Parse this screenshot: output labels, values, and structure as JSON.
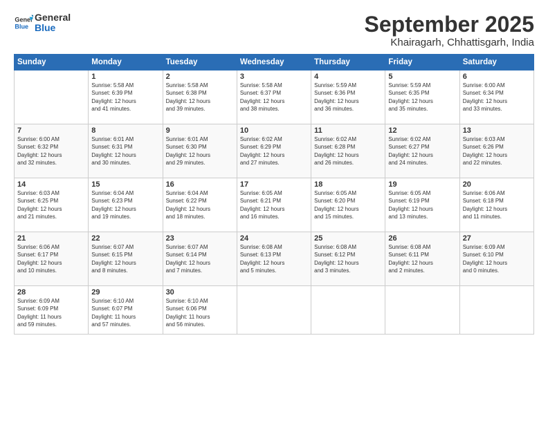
{
  "logo": {
    "line1": "General",
    "line2": "Blue"
  },
  "title": "September 2025",
  "subtitle": "Khairagarh, Chhattisgarh, India",
  "headers": [
    "Sunday",
    "Monday",
    "Tuesday",
    "Wednesday",
    "Thursday",
    "Friday",
    "Saturday"
  ],
  "weeks": [
    [
      {
        "num": "",
        "info": ""
      },
      {
        "num": "1",
        "info": "Sunrise: 5:58 AM\nSunset: 6:39 PM\nDaylight: 12 hours\nand 41 minutes."
      },
      {
        "num": "2",
        "info": "Sunrise: 5:58 AM\nSunset: 6:38 PM\nDaylight: 12 hours\nand 39 minutes."
      },
      {
        "num": "3",
        "info": "Sunrise: 5:58 AM\nSunset: 6:37 PM\nDaylight: 12 hours\nand 38 minutes."
      },
      {
        "num": "4",
        "info": "Sunrise: 5:59 AM\nSunset: 6:36 PM\nDaylight: 12 hours\nand 36 minutes."
      },
      {
        "num": "5",
        "info": "Sunrise: 5:59 AM\nSunset: 6:35 PM\nDaylight: 12 hours\nand 35 minutes."
      },
      {
        "num": "6",
        "info": "Sunrise: 6:00 AM\nSunset: 6:34 PM\nDaylight: 12 hours\nand 33 minutes."
      }
    ],
    [
      {
        "num": "7",
        "info": "Sunrise: 6:00 AM\nSunset: 6:32 PM\nDaylight: 12 hours\nand 32 minutes."
      },
      {
        "num": "8",
        "info": "Sunrise: 6:01 AM\nSunset: 6:31 PM\nDaylight: 12 hours\nand 30 minutes."
      },
      {
        "num": "9",
        "info": "Sunrise: 6:01 AM\nSunset: 6:30 PM\nDaylight: 12 hours\nand 29 minutes."
      },
      {
        "num": "10",
        "info": "Sunrise: 6:02 AM\nSunset: 6:29 PM\nDaylight: 12 hours\nand 27 minutes."
      },
      {
        "num": "11",
        "info": "Sunrise: 6:02 AM\nSunset: 6:28 PM\nDaylight: 12 hours\nand 26 minutes."
      },
      {
        "num": "12",
        "info": "Sunrise: 6:02 AM\nSunset: 6:27 PM\nDaylight: 12 hours\nand 24 minutes."
      },
      {
        "num": "13",
        "info": "Sunrise: 6:03 AM\nSunset: 6:26 PM\nDaylight: 12 hours\nand 22 minutes."
      }
    ],
    [
      {
        "num": "14",
        "info": "Sunrise: 6:03 AM\nSunset: 6:25 PM\nDaylight: 12 hours\nand 21 minutes."
      },
      {
        "num": "15",
        "info": "Sunrise: 6:04 AM\nSunset: 6:23 PM\nDaylight: 12 hours\nand 19 minutes."
      },
      {
        "num": "16",
        "info": "Sunrise: 6:04 AM\nSunset: 6:22 PM\nDaylight: 12 hours\nand 18 minutes."
      },
      {
        "num": "17",
        "info": "Sunrise: 6:05 AM\nSunset: 6:21 PM\nDaylight: 12 hours\nand 16 minutes."
      },
      {
        "num": "18",
        "info": "Sunrise: 6:05 AM\nSunset: 6:20 PM\nDaylight: 12 hours\nand 15 minutes."
      },
      {
        "num": "19",
        "info": "Sunrise: 6:05 AM\nSunset: 6:19 PM\nDaylight: 12 hours\nand 13 minutes."
      },
      {
        "num": "20",
        "info": "Sunrise: 6:06 AM\nSunset: 6:18 PM\nDaylight: 12 hours\nand 11 minutes."
      }
    ],
    [
      {
        "num": "21",
        "info": "Sunrise: 6:06 AM\nSunset: 6:17 PM\nDaylight: 12 hours\nand 10 minutes."
      },
      {
        "num": "22",
        "info": "Sunrise: 6:07 AM\nSunset: 6:15 PM\nDaylight: 12 hours\nand 8 minutes."
      },
      {
        "num": "23",
        "info": "Sunrise: 6:07 AM\nSunset: 6:14 PM\nDaylight: 12 hours\nand 7 minutes."
      },
      {
        "num": "24",
        "info": "Sunrise: 6:08 AM\nSunset: 6:13 PM\nDaylight: 12 hours\nand 5 minutes."
      },
      {
        "num": "25",
        "info": "Sunrise: 6:08 AM\nSunset: 6:12 PM\nDaylight: 12 hours\nand 3 minutes."
      },
      {
        "num": "26",
        "info": "Sunrise: 6:08 AM\nSunset: 6:11 PM\nDaylight: 12 hours\nand 2 minutes."
      },
      {
        "num": "27",
        "info": "Sunrise: 6:09 AM\nSunset: 6:10 PM\nDaylight: 12 hours\nand 0 minutes."
      }
    ],
    [
      {
        "num": "28",
        "info": "Sunrise: 6:09 AM\nSunset: 6:09 PM\nDaylight: 11 hours\nand 59 minutes."
      },
      {
        "num": "29",
        "info": "Sunrise: 6:10 AM\nSunset: 6:07 PM\nDaylight: 11 hours\nand 57 minutes."
      },
      {
        "num": "30",
        "info": "Sunrise: 6:10 AM\nSunset: 6:06 PM\nDaylight: 11 hours\nand 56 minutes."
      },
      {
        "num": "",
        "info": ""
      },
      {
        "num": "",
        "info": ""
      },
      {
        "num": "",
        "info": ""
      },
      {
        "num": "",
        "info": ""
      }
    ]
  ]
}
